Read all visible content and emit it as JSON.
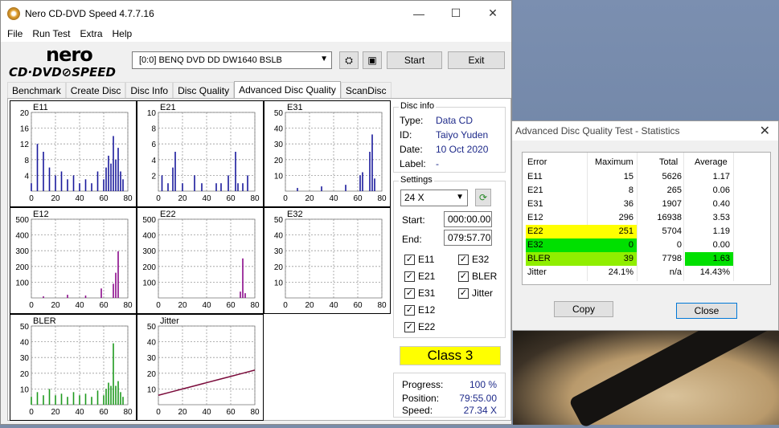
{
  "window": {
    "title": "Nero CD-DVD Speed 4.7.7.16",
    "minimize": "—",
    "maximize": "☐",
    "close": "✕"
  },
  "menu": [
    "File",
    "Run Test",
    "Extra",
    "Help"
  ],
  "logo": {
    "line1": "nero",
    "line2": "CD·DVD⊘SPEED"
  },
  "toolbar": {
    "drive": "[0:0]   BENQ DVD DD DW1640 BSLB",
    "start": "Start",
    "exit": "Exit"
  },
  "tabs": [
    "Benchmark",
    "Create Disc",
    "Disc Info",
    "Disc Quality",
    "Advanced Disc Quality",
    "ScanDisc"
  ],
  "disc_info": {
    "heading": "Disc info",
    "type_label": "Type:",
    "type": "Data CD",
    "id_label": "ID:",
    "id": "Taiyo Yuden",
    "date_label": "Date:",
    "date": "10 Oct 2020",
    "label_label": "Label:",
    "label": "-"
  },
  "settings": {
    "heading": "Settings",
    "speed": "24 X",
    "start_label": "Start:",
    "start": "000:00.00",
    "end_label": "End:",
    "end": "079:57.70",
    "checks": [
      {
        "label": "E11",
        "checked": true
      },
      {
        "label": "E32",
        "checked": true
      },
      {
        "label": "E21",
        "checked": true
      },
      {
        "label": "BLER",
        "checked": true
      },
      {
        "label": "E31",
        "checked": true
      },
      {
        "label": "Jitter",
        "checked": true
      },
      {
        "label": "E12",
        "checked": true
      },
      {
        "label": "E22",
        "checked": true
      }
    ]
  },
  "class_label": "Class 3",
  "progress": {
    "progress_label": "Progress:",
    "progress": "100 %",
    "position_label": "Position:",
    "position": "79:55.00",
    "speed_label": "Speed:",
    "speed": "27.34 X"
  },
  "chart_data": [
    {
      "type": "bar",
      "title": "E11",
      "ylim": [
        0,
        20
      ],
      "yticks": [
        4,
        8,
        12,
        16,
        20
      ],
      "xticks": [
        0,
        20,
        40,
        60,
        80
      ],
      "color": "#1a1a9c",
      "x": [
        0,
        5,
        10,
        15,
        20,
        25,
        30,
        35,
        40,
        45,
        50,
        55,
        60,
        62,
        64,
        66,
        68,
        70,
        72,
        74,
        76
      ],
      "values": [
        2,
        12,
        10,
        6,
        4,
        5,
        3,
        4,
        2,
        3,
        2,
        5,
        3,
        6,
        9,
        7,
        14,
        8,
        11,
        5,
        3
      ]
    },
    {
      "type": "bar",
      "title": "E21",
      "ylim": [
        0,
        10
      ],
      "yticks": [
        2,
        4,
        6,
        8,
        10
      ],
      "xticks": [
        0,
        20,
        40,
        60,
        80
      ],
      "color": "#1a1a9c",
      "x": [
        3,
        8,
        12,
        14,
        20,
        30,
        36,
        48,
        52,
        58,
        64,
        66,
        70,
        74
      ],
      "values": [
        2,
        1,
        3,
        5,
        1,
        2,
        1,
        1,
        1,
        2,
        5,
        1,
        1,
        2
      ]
    },
    {
      "type": "bar",
      "title": "E31",
      "ylim": [
        0,
        50
      ],
      "yticks": [
        10,
        20,
        30,
        40,
        50
      ],
      "xticks": [
        0,
        20,
        40,
        60,
        80
      ],
      "color": "#1a1a9c",
      "x": [
        10,
        30,
        50,
        62,
        64,
        70,
        72,
        74
      ],
      "values": [
        2,
        3,
        4,
        10,
        12,
        25,
        36,
        8
      ]
    },
    {
      "type": "bar",
      "title": "E12",
      "ylim": [
        0,
        500
      ],
      "yticks": [
        100,
        200,
        300,
        400,
        500
      ],
      "xticks": [
        0,
        20,
        40,
        60,
        80
      ],
      "color": "#8b0a8b",
      "x": [
        10,
        30,
        45,
        58,
        68,
        70,
        72
      ],
      "values": [
        10,
        20,
        15,
        60,
        90,
        160,
        296
      ]
    },
    {
      "type": "bar",
      "title": "E22",
      "ylim": [
        0,
        500
      ],
      "yticks": [
        100,
        200,
        300,
        400,
        500
      ],
      "xticks": [
        0,
        20,
        40,
        60,
        80
      ],
      "color": "#8b0a8b",
      "x": [
        68,
        70,
        72
      ],
      "values": [
        40,
        251,
        30
      ]
    },
    {
      "type": "bar",
      "title": "E32",
      "ylim": [
        0,
        50
      ],
      "yticks": [
        10,
        20,
        30,
        40,
        50
      ],
      "xticks": [
        0,
        20,
        40,
        60,
        80
      ],
      "color": "#8b0a8b",
      "x": [],
      "values": []
    },
    {
      "type": "bar",
      "title": "BLER",
      "ylim": [
        0,
        50
      ],
      "yticks": [
        10,
        20,
        30,
        40,
        50
      ],
      "xticks": [
        0,
        20,
        40,
        60,
        80
      ],
      "color": "#1e9a1e",
      "x": [
        0,
        5,
        10,
        15,
        20,
        25,
        30,
        35,
        40,
        45,
        50,
        55,
        60,
        62,
        64,
        66,
        68,
        70,
        72,
        74,
        76
      ],
      "values": [
        5,
        8,
        6,
        10,
        6,
        7,
        5,
        8,
        6,
        7,
        5,
        9,
        6,
        10,
        14,
        12,
        39,
        12,
        15,
        8,
        5
      ]
    },
    {
      "type": "line",
      "title": "Jitter",
      "ylim": [
        0,
        50
      ],
      "yticks": [
        10,
        20,
        30,
        40,
        50
      ],
      "xticks": [
        0,
        20,
        40,
        60,
        80
      ],
      "color": "#7a0a3a",
      "x": [
        0,
        10,
        20,
        30,
        40,
        50,
        60,
        70,
        80
      ],
      "values": [
        6,
        8,
        10,
        12,
        14,
        16,
        18,
        20,
        22
      ]
    }
  ],
  "stats": {
    "title": "Advanced Disc Quality Test - Statistics",
    "headers": [
      "Error",
      "Maximum",
      "Total",
      "Average"
    ],
    "rows": [
      [
        "E11",
        "15",
        "5626",
        "1.17"
      ],
      [
        "E21",
        "8",
        "265",
        "0.06"
      ],
      [
        "E31",
        "36",
        "1907",
        "0.40"
      ],
      [
        "E12",
        "296",
        "16938",
        "3.53"
      ],
      [
        "E22",
        "251",
        "5704",
        "1.19"
      ],
      [
        "E32",
        "0",
        "0",
        "0.00"
      ],
      [
        "BLER",
        "39",
        "7798",
        "1.63"
      ],
      [
        "Jitter",
        "24.1%",
        "n/a",
        "14.43%"
      ]
    ],
    "copy": "Copy",
    "close": "Close"
  }
}
